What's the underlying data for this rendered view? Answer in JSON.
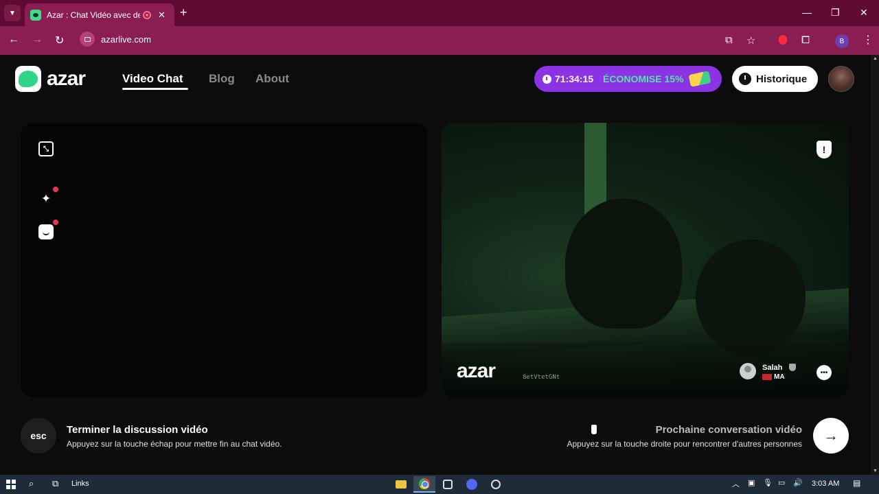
{
  "browser": {
    "tab_title": "Azar : Chat Vidéo avec de n",
    "url": "azarlive.com",
    "profile_initial": "B"
  },
  "header": {
    "logo_text": "azar",
    "nav": [
      "Video Chat",
      "Blog",
      "About"
    ],
    "promo_timer": "71:34:15",
    "promo_text": "ÉCONOMISE 15%",
    "history_label": "Historique"
  },
  "remote_video": {
    "watermark": "azar",
    "code": "8etVtetGNt",
    "peer_name": "Salah",
    "peer_country": "MA"
  },
  "footer": {
    "esc_label": "esc",
    "end_title": "Terminer la discussion vidéo",
    "end_subtitle": "Appuyez sur la touche échap pour mettre fin au chat vidéo.",
    "next_title": "Prochaine conversation vidéo",
    "next_subtitle": "Appuyez sur la touche droite pour rencontrer d'autres personnes"
  },
  "taskbar": {
    "links_label": "Links",
    "time": "3:03 AM"
  },
  "colors": {
    "browser_dark": "#5e0a33",
    "browser_accent": "#8a1d52",
    "promo_bg": "#8c33e6",
    "promo_text": "#55e3a6"
  }
}
